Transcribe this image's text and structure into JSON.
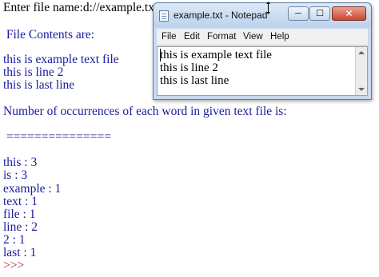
{
  "shell": {
    "lines": [
      "Enter file name:d://example.txt",
      "",
      " File Contents are:",
      "",
      "this is example text file",
      "this is line 2",
      "this is last line",
      "",
      "Number of occurrences of each word in given text file is:",
      "",
      " ===============",
      "",
      "this : 3",
      "is : 3",
      "example : 1",
      "text : 1",
      "file : 1",
      "line : 2",
      "2 : 1",
      "last : 1"
    ],
    "prompt": ">>>"
  },
  "notepad": {
    "title": "example.txt - Notepad",
    "buttons": {
      "minimize": "─",
      "maximize": "☐",
      "close": "✕"
    },
    "menu": [
      "File",
      "Edit",
      "Format",
      "View",
      "Help"
    ],
    "content": "this is example text file\nthis is line 2\nthis is last line"
  }
}
